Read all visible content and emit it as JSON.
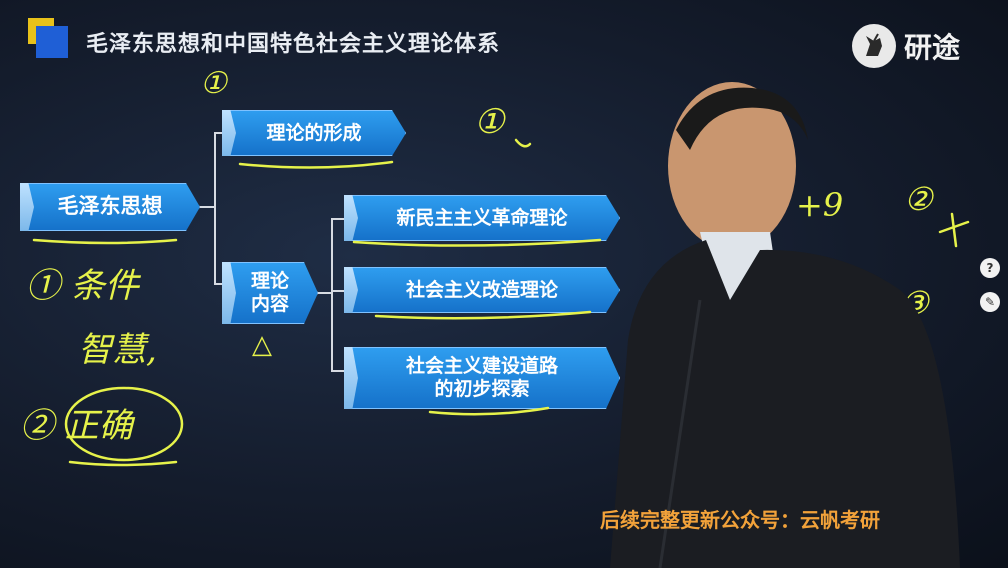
{
  "header": {
    "title": "毛泽东思想和中国特色社会主义理论体系"
  },
  "logo": {
    "icon": "unicorn-logo-icon",
    "text": "研途"
  },
  "diagram": {
    "root": "毛泽东思想",
    "branch_formation": "理论的形成",
    "branch_content": "理论\n内容",
    "sub_items": [
      "新民主主义革命理论",
      "社会主义改造理论",
      "社会主义建设道路\n的初步探索"
    ]
  },
  "handwriting": {
    "note1": "①",
    "note2": "①",
    "note3": "① 条件",
    "note4": "智慧,",
    "note5": "② 正确",
    "note6": "②",
    "note7": "③",
    "note8": "△",
    "note9": "+9"
  },
  "subtitle": "后续完整更新公众号：云帆考研",
  "side_buttons": [
    "?",
    "✎"
  ],
  "colors": {
    "box_blue": "#1f86e0",
    "handwriting": "#e6f24a",
    "subtitle": "#f2a23a"
  }
}
